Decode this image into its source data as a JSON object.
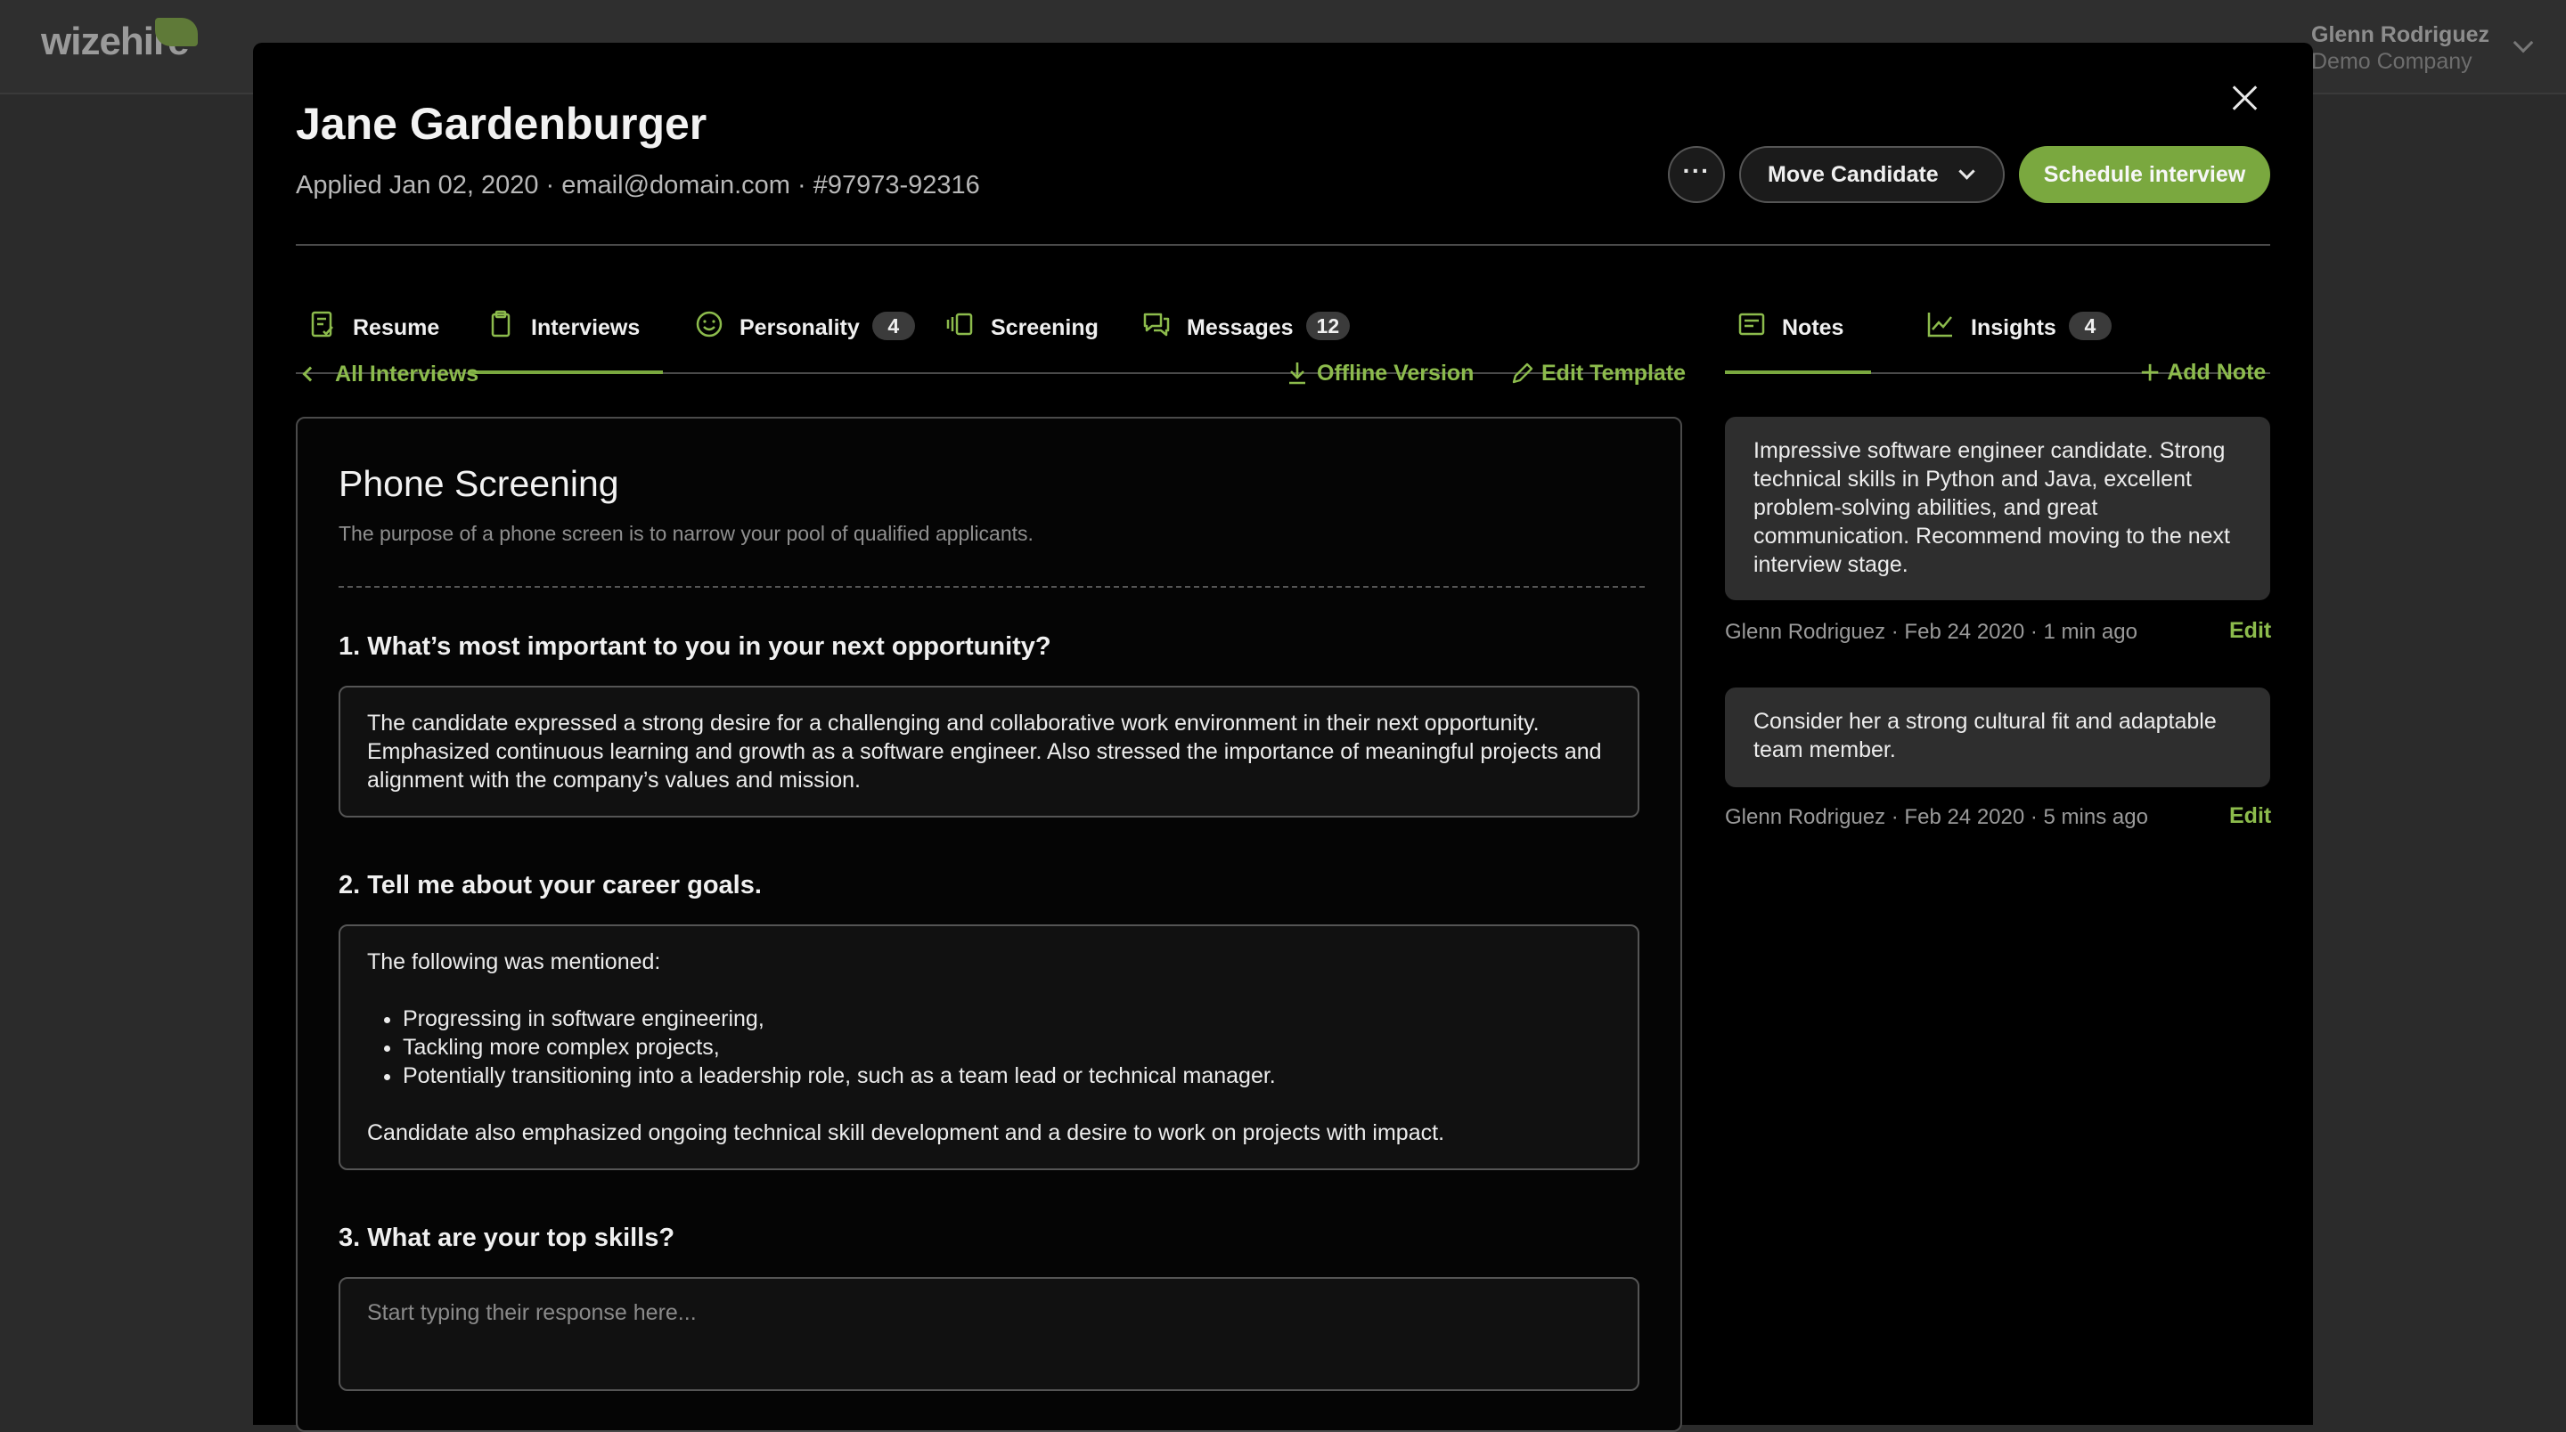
{
  "app": {
    "logo": "wizehire",
    "user_name": "Glenn Rodriguez",
    "company": "Demo Company"
  },
  "candidate": {
    "name": "Jane Gardenburger",
    "meta": "Applied Jan 02, 2020 · email@domain.com · #97973-92316"
  },
  "actions": {
    "more_label": "···",
    "move_label": "Move Candidate",
    "schedule_label": "Schedule interview"
  },
  "tabs": [
    {
      "label": "Resume",
      "icon": "resume-icon"
    },
    {
      "label": "Interviews",
      "icon": "clipboard-icon",
      "active": true
    },
    {
      "label": "Personality",
      "icon": "smile-icon",
      "badge": "4"
    },
    {
      "label": "Screening",
      "icon": "cards-icon"
    },
    {
      "label": "Messages",
      "icon": "chat-icon",
      "badge": "12"
    }
  ],
  "side_tabs": [
    {
      "label": "Notes",
      "icon": "note-icon",
      "active": true
    },
    {
      "label": "Insights",
      "icon": "chart-icon",
      "badge": "4"
    }
  ],
  "toolbar": {
    "back_label": "All Interviews",
    "offline_label": "Offline Version",
    "edit_template_label": "Edit Template",
    "add_note_label": "Add Note"
  },
  "interview": {
    "title": "Phone Screening",
    "description": "The purpose of a phone screen is to narrow your pool of qualified applicants.",
    "questions": [
      {
        "label": "1. What’s most important to you in your next opportunity?",
        "answer": "The candidate expressed a strong desire for a challenging and collaborative work environment in their next opportunity. Emphasized continuous learning and growth as a software engineer. Also stressed the importance of meaningful projects and alignment with the company’s values and mission."
      },
      {
        "label": "2. Tell me about your career goals.",
        "answer_intro": "The following was mentioned:",
        "answer_items": [
          "Progressing in software engineering,",
          "Tackling more complex projects,",
          "Potentially transitioning into a leadership role, such as a team lead or technical manager."
        ],
        "answer_outro": "Candidate also emphasized ongoing technical skill development and a desire to work on projects with impact."
      },
      {
        "label": "3. What are your top skills?",
        "placeholder": "Start typing their response here..."
      }
    ]
  },
  "notes": [
    {
      "text": "Impressive software engineer candidate. Strong technical skills in Python and Java, excellent problem-solving abilities, and great communication. Recommend moving to the next interview stage.",
      "meta": "Glenn Rodriguez · Feb 24 2020 · 1 min ago",
      "edit_label": "Edit"
    },
    {
      "text": "Consider her a strong cultural fit and adaptable team member.",
      "meta": "Glenn Rodriguez · Feb 24 2020 · 5 mins ago",
      "edit_label": "Edit"
    }
  ],
  "colors": {
    "accent": "#7aa83f",
    "link": "#8cbb4c",
    "background": "#000000"
  }
}
